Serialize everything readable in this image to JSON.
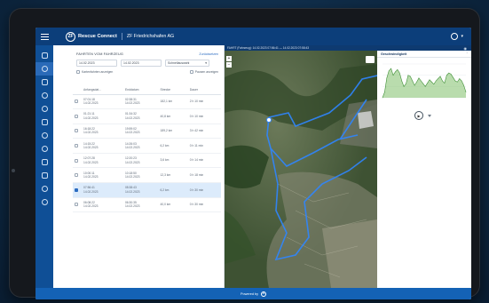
{
  "header": {
    "logo": "ZF",
    "app_title": "Rescue Connect",
    "company": "ZF Friedrichshafen AG"
  },
  "trips": {
    "title": "FAHRTEN VOM FAHRZEUG",
    "reset_link": "Zurücksetzen",
    "date_from": "14.02.2023",
    "date_to": "14.02.2023",
    "select_value": "Schnellauswahl",
    "checkbox_left": "Kartenfahrten anzeigen",
    "checkbox_right": "Pausen anzeigen",
    "columns": [
      "Anfangsdat...",
      "Enddatum",
      "Strecke",
      "Dauer"
    ],
    "rows": [
      {
        "start": "07:01:18\n14.02.2023",
        "end": "02:38:31\n14.02.2023",
        "dist": "182,1 km",
        "dur": "2 h 10 min",
        "selected": false
      },
      {
        "start": "01:21:11\n14.02.2023",
        "end": "01:34:32\n14.02.2023",
        "dist": "40,8 km",
        "dur": "0 h 10 min",
        "selected": false
      },
      {
        "start": "16:18:22\n14.02.2023",
        "end": "19:59:02\n14.02.2023",
        "dist": "189,2 km",
        "dur": "3 h 42 min",
        "selected": false
      },
      {
        "start": "14:15:22\n14.02.2023",
        "end": "14:26:03\n14.02.2023",
        "dist": "6,2 km",
        "dur": "0 h 11 min",
        "selected": false
      },
      {
        "start": "12:07:28\n14.02.2023",
        "end": "12:20:23\n14.02.2023",
        "dist": "3,6 km",
        "dur": "0 h 14 min",
        "selected": false
      },
      {
        "start": "10:00:11\n14.02.2023",
        "end": "10:18:50\n14.02.2023",
        "dist": "12,3 km",
        "dur": "0 h 18 min",
        "selected": false
      },
      {
        "start": "07:56:41\n14.02.2023",
        "end": "08:38:43\n14.02.2023",
        "dist": "6,2 km",
        "dur": "0 h 30 min",
        "selected": true
      },
      {
        "start": "06:08:22\n14.02.2023",
        "end": "06:30:35\n14.02.2023",
        "dist": "40,0 km",
        "dur": "0 h 30 min",
        "selected": false
      }
    ]
  },
  "map": {
    "strip_text": "FAHRT (Fahrzeug): 14.02.2023 07:56:41 — 14.02.2023 07:58:43",
    "zoom_in": "+",
    "zoom_out": "−"
  },
  "speed_chart": {
    "title": "Geschwindigkeit"
  },
  "footer": {
    "powered_by": "Powered by"
  },
  "chart_data": {
    "type": "area",
    "title": "Geschwindigkeit",
    "x": [
      0,
      1,
      2,
      3,
      4,
      5,
      6,
      7,
      8,
      9,
      10,
      11,
      12,
      13,
      14,
      15,
      16,
      17,
      18,
      19,
      20,
      21,
      22,
      23,
      24,
      25,
      26,
      27,
      28,
      29,
      30,
      31,
      32,
      33,
      34,
      35,
      36,
      37,
      38,
      39
    ],
    "series": [
      {
        "values": [
          0,
          10,
          35,
          48,
          52,
          40,
          46,
          50,
          44,
          30,
          20,
          25,
          40,
          38,
          30,
          22,
          28,
          35,
          30,
          25,
          20,
          26,
          32,
          28,
          24,
          30,
          34,
          38,
          30,
          26,
          40,
          44,
          42,
          36,
          30,
          28,
          34,
          30,
          22,
          10
        ]
      }
    ],
    "ylim": [
      0,
      60
    ],
    "grid": true
  }
}
